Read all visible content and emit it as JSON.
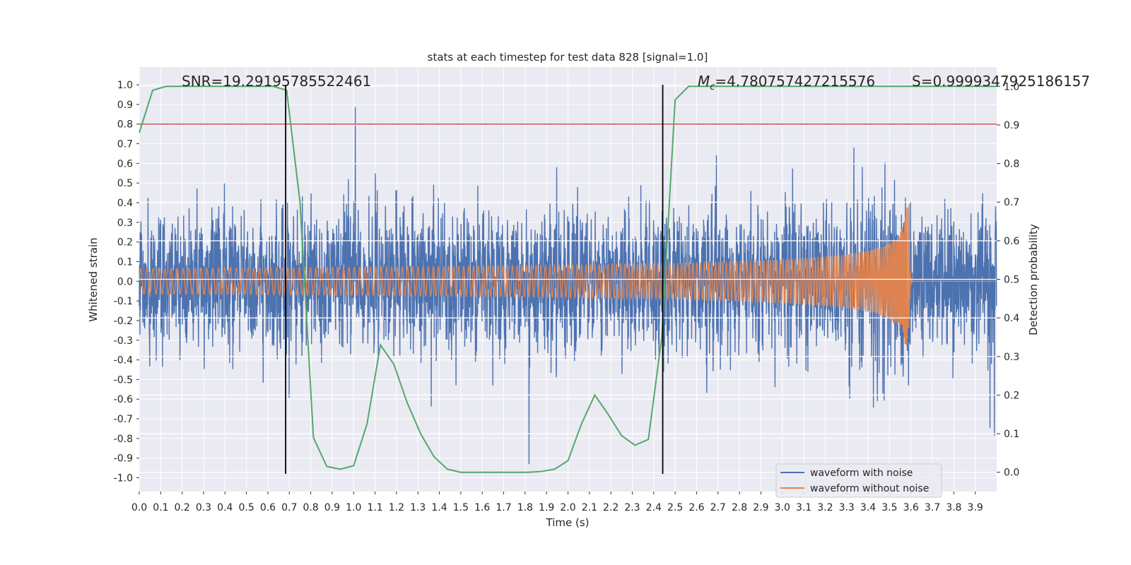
{
  "chart_data": {
    "type": "line",
    "title": "stats at each timestep for test data 828 [signal=1.0]",
    "xlabel": "Time (s)",
    "ylabel": "Whitened strain",
    "ylabel_right": "Detection probability",
    "xlim": [
      0.0,
      4.0
    ],
    "ylim": [
      -1.07,
      1.09
    ],
    "ylim_right": [
      -0.05,
      1.05
    ],
    "grid": true,
    "x_ticks": [
      "0.0",
      "0.1",
      "0.2",
      "0.3",
      "0.4",
      "0.5",
      "0.6",
      "0.7",
      "0.8",
      "0.9",
      "1.0",
      "1.1",
      "1.2",
      "1.3",
      "1.4",
      "1.5",
      "1.6",
      "1.7",
      "1.8",
      "1.9",
      "2.0",
      "2.1",
      "2.2",
      "2.3",
      "2.4",
      "2.5",
      "2.6",
      "2.7",
      "2.8",
      "2.9",
      "3.0",
      "3.1",
      "3.2",
      "3.3",
      "3.4",
      "3.5",
      "3.6",
      "3.7",
      "3.8",
      "3.9"
    ],
    "y_ticks": [
      "1.0",
      "0.9",
      "0.8",
      "0.7",
      "0.6",
      "0.5",
      "0.4",
      "0.3",
      "0.2",
      "0.1",
      "0.0",
      "-0.1",
      "-0.2",
      "-0.3",
      "-0.4",
      "-0.5",
      "-0.6",
      "-0.7",
      "-0.8",
      "-0.9",
      "-1.0"
    ],
    "y_ticks_right": [
      "1.0",
      "0.9",
      "0.8",
      "0.7",
      "0.6",
      "0.5",
      "0.4",
      "0.3",
      "0.2",
      "0.1",
      "0.0"
    ],
    "annotations": {
      "snr": "SNR=19.29195785522461",
      "mc_symbol": "M",
      "mc_sub": "c",
      "mc_value": "=4.780757427215576",
      "s": "S=0.9999347925186157"
    },
    "legend": {
      "placement": "lower-right",
      "entries": [
        "waveform with noise",
        "waveform without noise"
      ]
    },
    "series": [
      {
        "name": "waveform with noise",
        "axis": "left",
        "color": "#4c72b0",
        "description_range": [
          -1.0,
          1.0
        ]
      },
      {
        "name": "waveform without noise",
        "axis": "left",
        "color": "#dd8452",
        "merger_time": 3.59,
        "peak": 0.45,
        "trough": -0.58
      },
      {
        "axis": "right",
        "color": "#55a868",
        "x": [
          0,
          0.0625,
          0.125,
          0.1875,
          0.25,
          0.3125,
          0.375,
          0.4375,
          0.5,
          0.5625,
          0.625,
          0.6875,
          0.75,
          0.8125,
          0.875,
          0.9375,
          1.0,
          1.0625,
          1.125,
          1.1875,
          1.25,
          1.3125,
          1.375,
          1.4375,
          1.5,
          1.5625,
          1.625,
          1.6875,
          1.75,
          1.8125,
          1.875,
          1.9375,
          2.0,
          2.0625,
          2.125,
          2.1875,
          2.25,
          2.3125,
          2.375,
          2.4375,
          2.5,
          2.5625,
          2.625,
          2.6875,
          2.75,
          2.8125,
          2.875,
          2.9375,
          3.0,
          3.0625,
          3.125,
          3.1875,
          3.25,
          3.3125,
          3.375,
          3.4375,
          3.5,
          3.5625,
          3.625,
          3.6875,
          3.75,
          3.8125,
          3.875,
          3.9375,
          4.0
        ],
        "y": [
          0.88,
          0.99,
          1.0,
          1.0,
          1.0,
          1.0,
          1.0,
          1.0,
          1.0,
          1.0,
          1.0,
          0.99,
          0.7,
          0.09,
          0.015,
          0.008,
          0.017,
          0.125,
          0.33,
          0.28,
          0.18,
          0.1,
          0.04,
          0.008,
          0.0,
          0.0,
          0.0,
          0.0,
          0.0,
          0.0,
          0.002,
          0.008,
          0.03,
          0.125,
          0.2,
          0.15,
          0.095,
          0.07,
          0.085,
          0.35,
          0.965,
          1.0,
          1.0,
          1.0,
          1.0,
          1.0,
          1.0,
          1.0,
          1.0,
          1.0,
          1.0,
          1.0,
          1.0,
          1.0,
          1.0,
          1.0,
          1.0,
          1.0,
          1.0,
          1.0,
          1.0,
          1.0,
          1.0,
          1.0,
          1.0
        ]
      }
    ],
    "hlines": [
      {
        "axis": "left",
        "y": 0.8,
        "color": "#c44e52"
      }
    ],
    "vlines": [
      {
        "x": 0.683,
        "ymin": -0.98,
        "ymax": 1.0,
        "color": "#000000"
      },
      {
        "x": 2.442,
        "ymin": -0.98,
        "ymax": 1.0,
        "color": "#000000"
      }
    ]
  }
}
